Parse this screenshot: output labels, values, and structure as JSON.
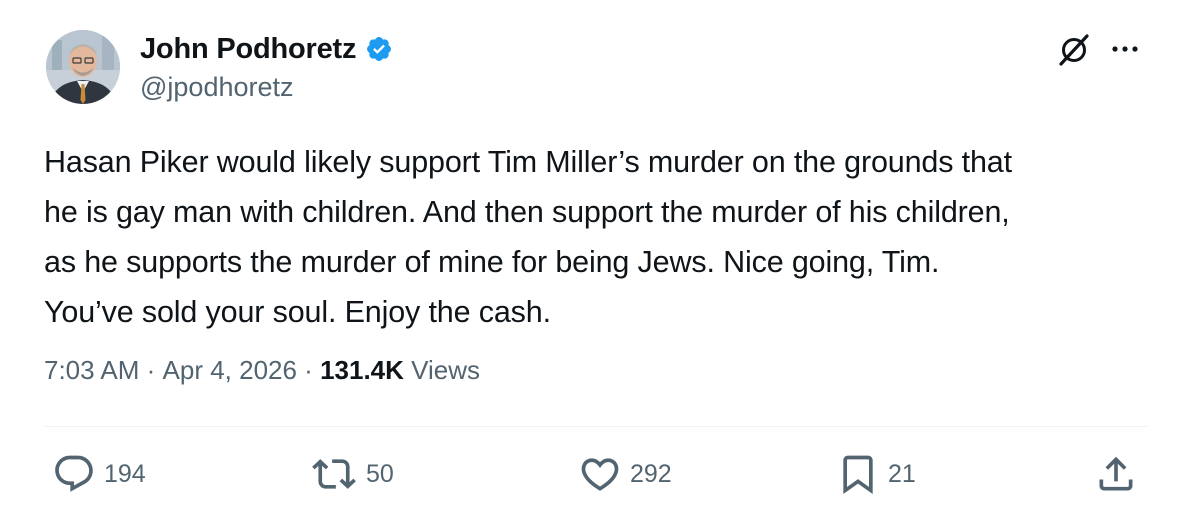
{
  "author": {
    "display_name": "John Podhoretz",
    "handle": "@jpodhoretz",
    "verified": true,
    "verified_color": "#1d9bf0"
  },
  "tweet": {
    "text": "Hasan Piker would likely support Tim Miller’s murder on the grounds that\nhe is gay man with children. And then support the murder of his children,\nas he supports the murder of mine for being Jews. Nice going, Tim.\nYou’ve sold your soul. Enjoy the cash.",
    "time": "7:03 AM",
    "separator": " · ",
    "date": "Apr 4, 2026",
    "views_count": "131.4K",
    "views_label": " Views"
  },
  "actions": {
    "replies": "194",
    "reposts": "50",
    "likes": "292",
    "bookmarks": "21"
  },
  "icons": {
    "header": [
      "grok-icon",
      "more-icon"
    ],
    "actions": [
      "reply-icon",
      "repost-icon",
      "like-icon",
      "bookmark-icon",
      "share-icon"
    ]
  },
  "colors": {
    "text_primary": "#0f1419",
    "text_secondary": "#536471",
    "divider": "#eff3f4"
  }
}
